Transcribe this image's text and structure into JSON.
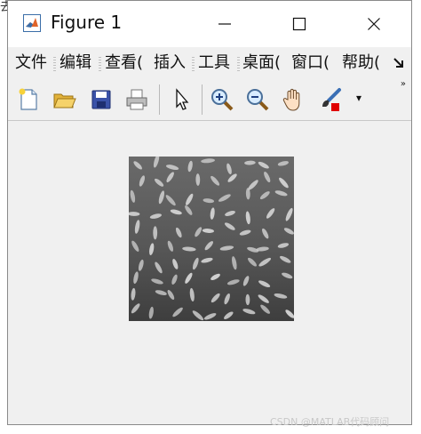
{
  "background_fragment": "去",
  "window": {
    "title": "Figure 1",
    "controls": {
      "minimize": "—",
      "maximize": "☐",
      "close": "✕"
    }
  },
  "menu": {
    "items": [
      "文件",
      "编辑",
      "查看(",
      "插入",
      "工具",
      "桌面(",
      "窗口(",
      "帮助("
    ],
    "overflow_icon": "arrow-down-right-icon"
  },
  "toolbar": {
    "buttons": [
      {
        "name": "new-figure-icon"
      },
      {
        "name": "open-folder-icon"
      },
      {
        "name": "save-icon"
      },
      {
        "name": "print-icon"
      },
      {
        "name": "pointer-icon"
      },
      {
        "name": "zoom-in-icon"
      },
      {
        "name": "zoom-out-icon"
      },
      {
        "name": "pan-hand-icon"
      },
      {
        "name": "brush-icon"
      }
    ],
    "overflow": "»",
    "brush_dropdown": "▾"
  },
  "figure": {
    "image_type": "grayscale rice grains",
    "colors": {
      "background": "#5a5a5a",
      "grain": "#cfcfcf"
    }
  },
  "watermark": "CSDN @MATLAB代码顾问"
}
